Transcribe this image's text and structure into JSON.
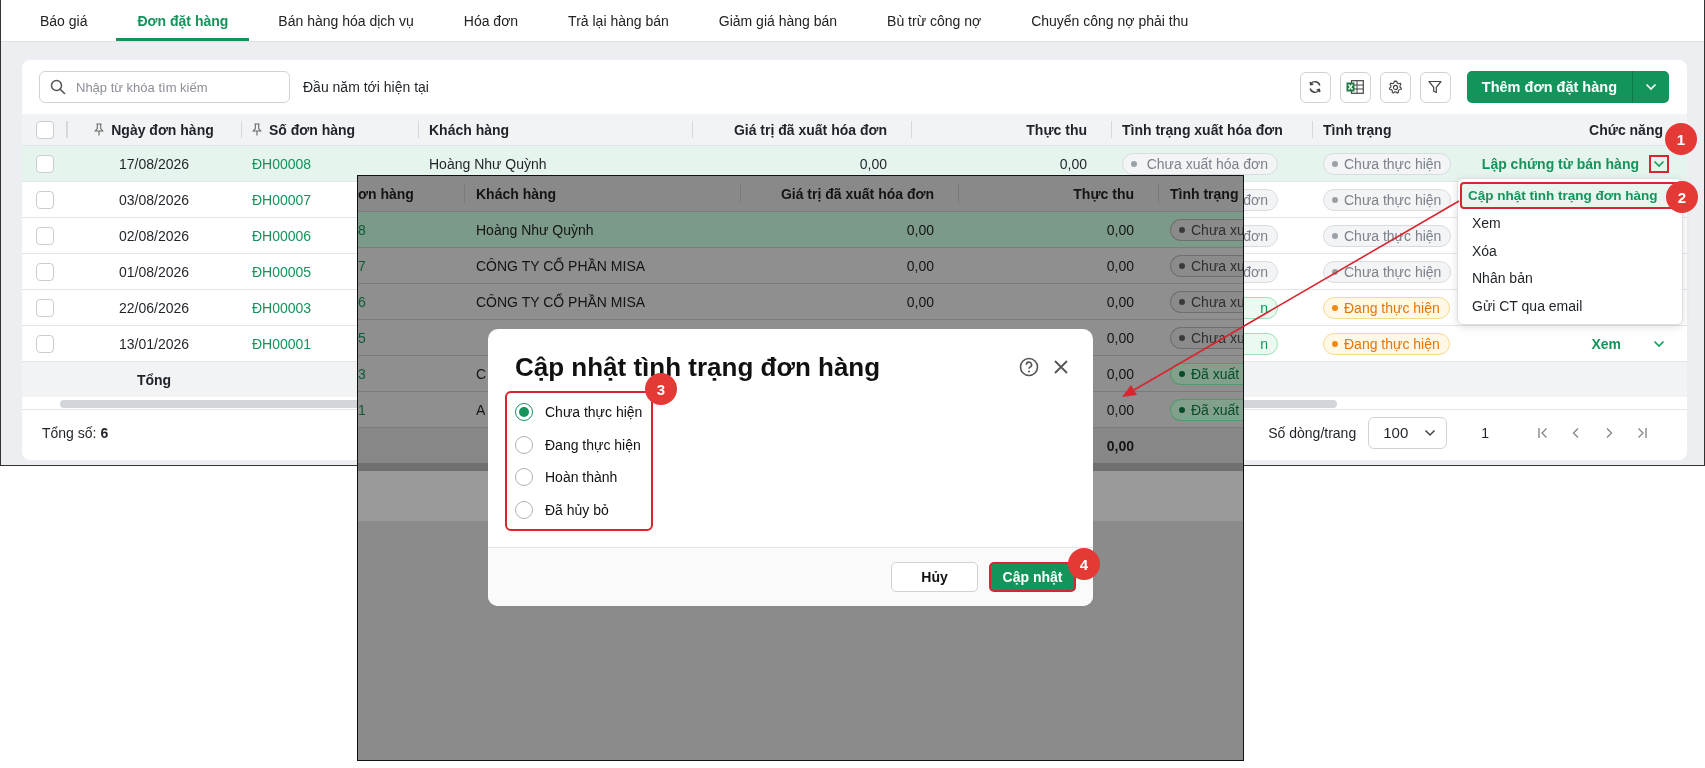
{
  "tabs": [
    {
      "label": "Báo giá",
      "selected": false
    },
    {
      "label": "Đơn đặt hàng",
      "selected": true
    },
    {
      "label": "Bán hàng hóa dịch vụ",
      "selected": false
    },
    {
      "label": "Hóa đơn",
      "selected": false
    },
    {
      "label": "Trả lại hàng bán",
      "selected": false
    },
    {
      "label": "Giảm giá hàng bán",
      "selected": false
    },
    {
      "label": "Bù trừ công nợ",
      "selected": false
    },
    {
      "label": "Chuyển công nợ phải thu",
      "selected": false
    }
  ],
  "toolbar": {
    "search": {
      "placeholder": "Nhập từ khóa tìm kiếm"
    },
    "period": "Đầu năm tới hiện tại",
    "add_button": "Thêm đơn đặt hàng"
  },
  "table": {
    "header_checked": false,
    "columns": [
      {
        "label": "Ngày đơn hàng",
        "pinned": true
      },
      {
        "label": "Số đơn hàng",
        "pinned": true
      },
      {
        "label": "Khách hàng",
        "pinned": false
      },
      {
        "label": "Giá trị đã xuất hóa đơn",
        "pinned": false
      },
      {
        "label": "Thực thu",
        "pinned": false
      },
      {
        "label": "Tình trạng xuất hóa đơn",
        "pinned": false
      },
      {
        "label": "Tình trạng",
        "pinned": false
      },
      {
        "label": "Chức năng",
        "pinned": false
      }
    ],
    "rows": [
      {
        "checked": false,
        "selected": true,
        "date": "17/08/2026",
        "number": "ĐH00008",
        "customer": "Hoàng Như Quỳnh",
        "invoiced": "0,00",
        "collected": "0,00",
        "invoice_status": {
          "text": "Chưa xuất hóa đơn",
          "kind": "pending"
        },
        "status": {
          "text": "Chưa thực hiện",
          "kind": "pending"
        },
        "action": "Lập chứng từ bán hàng",
        "annotated": true
      },
      {
        "checked": false,
        "selected": false,
        "date": "03/08/2026",
        "number": "ĐH00007",
        "invoice_status": {
          "text": "đơn",
          "kind": "pending"
        },
        "status": {
          "text": "Chưa thực hiện",
          "kind": "pending"
        }
      },
      {
        "checked": false,
        "selected": false,
        "date": "02/08/2026",
        "number": "ĐH00006",
        "invoice_status": {
          "text": "đơn",
          "kind": "pending"
        },
        "status": {
          "text": "Chưa thực hiện",
          "kind": "pending"
        }
      },
      {
        "checked": false,
        "selected": false,
        "date": "01/08/2026",
        "number": "ĐH00005",
        "invoice_status": {
          "text": "đơn",
          "kind": "pending"
        },
        "status": {
          "text": "Chưa thực hiện",
          "kind": "pending"
        }
      },
      {
        "checked": false,
        "selected": false,
        "date": "22/06/2026",
        "number": "ĐH00003",
        "invoice_status": {
          "text": "n",
          "kind": "done"
        },
        "status": {
          "text": "Đang thực hiện",
          "kind": "in_progress"
        }
      },
      {
        "checked": false,
        "selected": false,
        "date": "13/01/2026",
        "number": "ĐH00001",
        "invoice_status": {
          "text": "n",
          "kind": "done"
        },
        "status": {
          "text": "Đang thực hiện",
          "kind": "in_progress"
        },
        "action": "Xem",
        "annotated": false
      }
    ],
    "total_label": "Tổng"
  },
  "footer": {
    "total_label": "Tổng số:",
    "total": "6",
    "page_size_label": "Số dòng/trang",
    "page_size": "100",
    "page": "1"
  },
  "menu": {
    "items": [
      {
        "label": "Cập nhật tình trạng đơn hàng",
        "selected": true
      },
      {
        "label": "Xem",
        "selected": false
      },
      {
        "label": "Xóa",
        "selected": false
      },
      {
        "label": "Nhân bản",
        "selected": false
      },
      {
        "label": "Gửi CT qua email",
        "selected": false
      }
    ]
  },
  "inset": {
    "columns": [
      "ơn hàng",
      "Khách hàng",
      "Giá trị đã xuất hóa đơn",
      "Thực thu",
      "Tình trạng"
    ],
    "rows": [
      {
        "selected": true,
        "number": "8",
        "customer": "Hoàng Như Quỳnh",
        "invoiced": "0,00",
        "collected": "0,00",
        "invoice_status": {
          "text": "Chưa xu",
          "kind": "pending"
        }
      },
      {
        "selected": false,
        "number": "7",
        "customer": "CÔNG TY CỔ PHẦN MISA",
        "invoiced": "0,00",
        "collected": "0,00",
        "invoice_status": {
          "text": "Chưa xu",
          "kind": "pending"
        }
      },
      {
        "selected": false,
        "number": "6",
        "customer": "CÔNG TY CỔ PHẦN MISA",
        "invoiced": "0,00",
        "collected": "0,00",
        "invoice_status": {
          "text": "Chưa xu",
          "kind": "pending"
        }
      },
      {
        "selected": false,
        "number": "5",
        "collected": "0,00",
        "invoice_status": {
          "text": "Chưa xu",
          "kind": "pending"
        }
      },
      {
        "selected": false,
        "number": "3",
        "customer": "C",
        "collected": "0,00",
        "invoice_status": {
          "text": "Đã xuất",
          "kind": "done"
        }
      },
      {
        "selected": false,
        "number": "1",
        "customer": "A",
        "collected": "0,00",
        "invoice_status": {
          "text": "Đã xuất",
          "kind": "done"
        }
      }
    ],
    "total": "0,00"
  },
  "dialog": {
    "title": "Cập nhật tình trạng đơn hàng",
    "options": [
      {
        "label": "Chưa thực hiện",
        "selected": true
      },
      {
        "label": "Đang thực hiện",
        "selected": false
      },
      {
        "label": "Hoàn thành",
        "selected": false
      },
      {
        "label": "Đã hủy bỏ",
        "selected": false
      }
    ],
    "cancel": "Hủy",
    "confirm": "Cập nhật"
  },
  "markers": [
    "1",
    "2",
    "3",
    "4"
  ]
}
